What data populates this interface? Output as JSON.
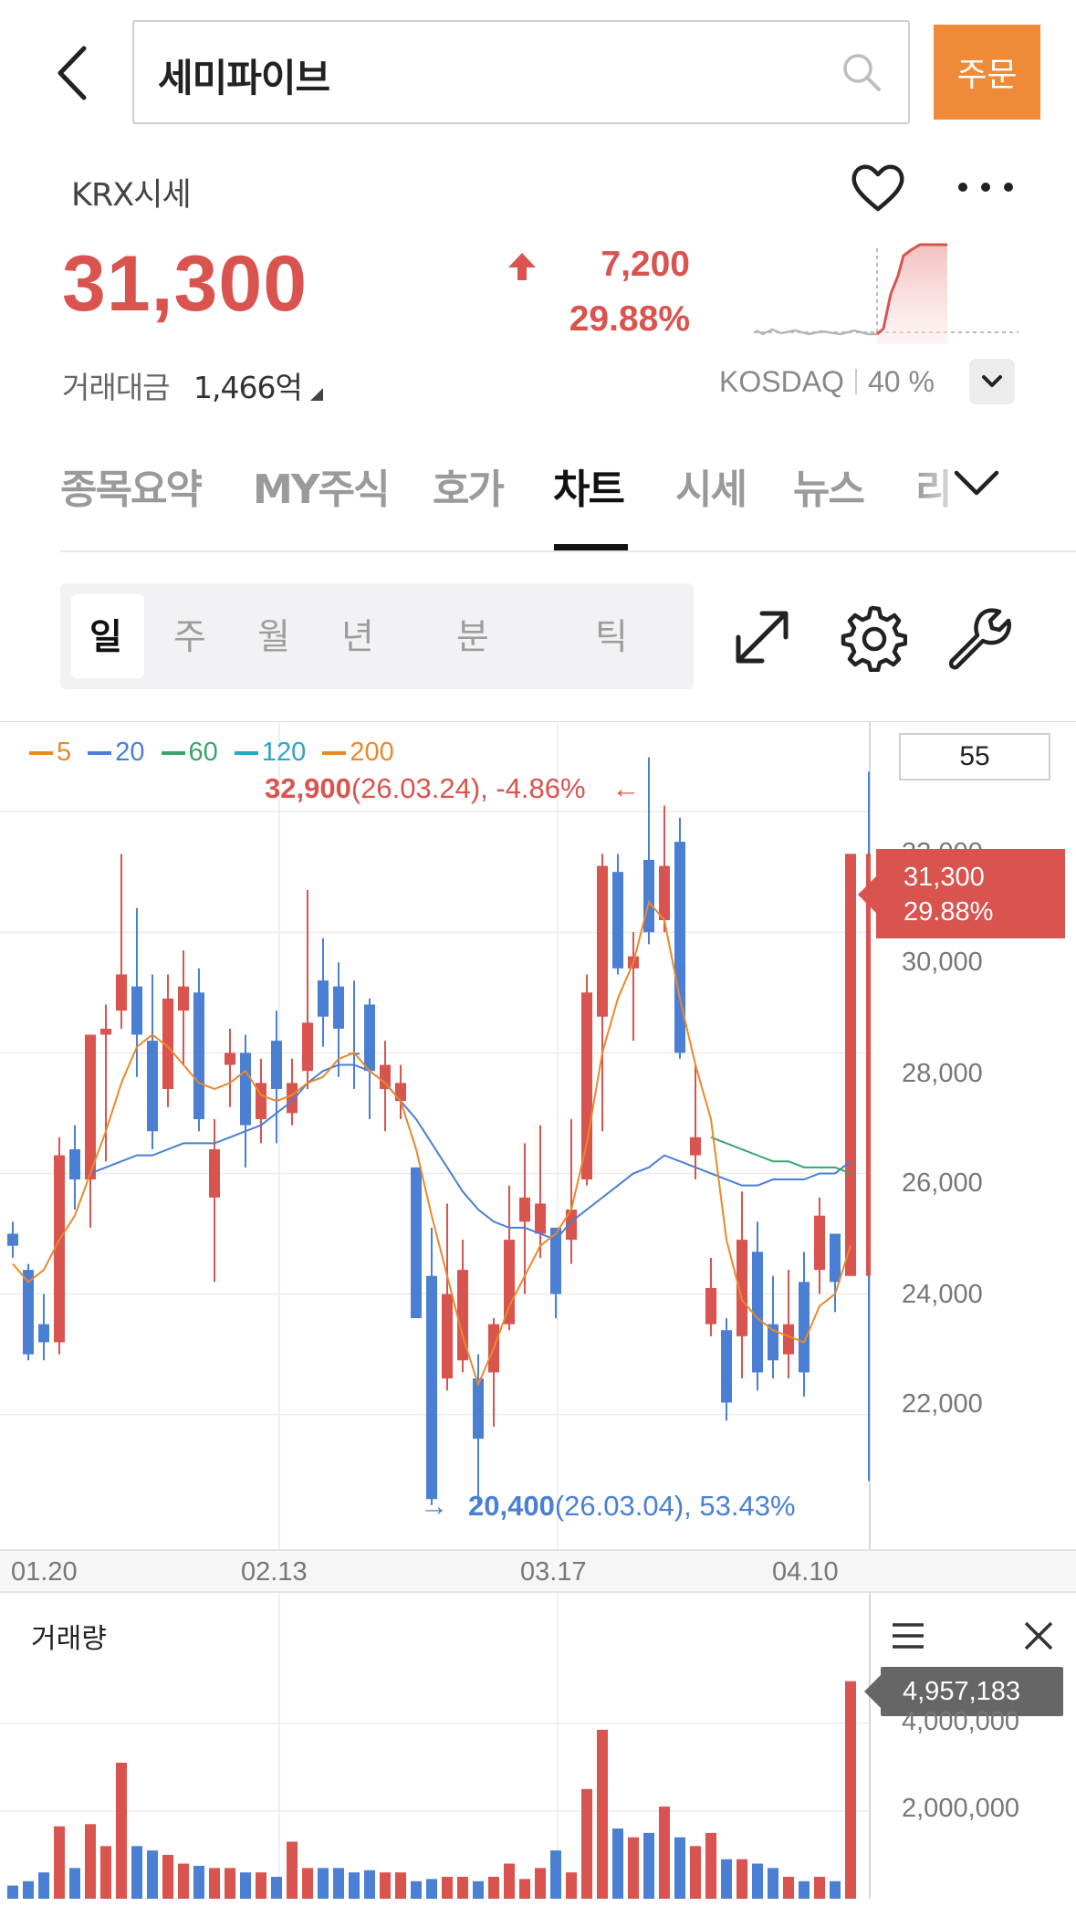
{
  "header": {
    "search_value": "세미파이브",
    "order_label": "주문"
  },
  "quote": {
    "market_label": "KRX시세",
    "price": "31,300",
    "change_abs": "7,200",
    "change_pct": "29.88%",
    "turnover_label": "거래대금",
    "turnover_value": "1,466억",
    "market_index": "KOSDAQ",
    "market_pct": "40 %"
  },
  "tabs": [
    {
      "label": "종목요약"
    },
    {
      "label": "MY주식"
    },
    {
      "label": "호가"
    },
    {
      "label": "차트"
    },
    {
      "label": "시세"
    },
    {
      "label": "뉴스"
    },
    {
      "label": "리"
    }
  ],
  "periods": [
    {
      "label": "일"
    },
    {
      "label": "주"
    },
    {
      "label": "월"
    },
    {
      "label": "년"
    },
    {
      "label": "분"
    },
    {
      "label": "틱"
    }
  ],
  "chart": {
    "count": "55",
    "legend": [
      {
        "label": "5",
        "color": "#e8892b"
      },
      {
        "label": "20",
        "color": "#4a7fd4"
      },
      {
        "label": "60",
        "color": "#3aa56a"
      },
      {
        "label": "120",
        "color": "#2aa7c8"
      },
      {
        "label": "200",
        "color": "#e8892b"
      }
    ],
    "max_note_value": "32,900",
    "max_note_detail": "(26.03.24), -4.86%",
    "max_arrow": "←",
    "min_note_value": "20,400",
    "min_note_detail": "(26.03.04), 53.43%",
    "min_arrow": "→",
    "tag_price": "31,300",
    "tag_pct": "29.88%",
    "y_ticks": [
      "32,000",
      "30,000",
      "28,000",
      "26,000",
      "24,000",
      "22,000"
    ],
    "x_ticks": [
      "01.20",
      "02.13",
      "03.17",
      "04.10"
    ],
    "volume_title": "거래량",
    "volume_tag": "4,957,183",
    "volume_ticks": [
      "4,000,000",
      "2,000,000"
    ]
  },
  "chart_data": {
    "type": "candlestick",
    "ylim": [
      19800,
      33500
    ],
    "candles": [
      {
        "o": 24800,
        "h": 25200,
        "l": 24600,
        "c": 25000,
        "up": false
      },
      {
        "o": 24400,
        "h": 24500,
        "l": 22900,
        "c": 23000,
        "up": false
      },
      {
        "o": 23500,
        "h": 24000,
        "l": 22900,
        "c": 23200,
        "up": false
      },
      {
        "o": 23200,
        "h": 26600,
        "l": 23000,
        "c": 26300,
        "up": true
      },
      {
        "o": 26400,
        "h": 26800,
        "l": 25400,
        "c": 25900,
        "up": false
      },
      {
        "o": 25900,
        "h": 28300,
        "l": 25100,
        "c": 28300,
        "up": true
      },
      {
        "o": 28300,
        "h": 28800,
        "l": 26200,
        "c": 28400,
        "up": true
      },
      {
        "o": 28700,
        "h": 31300,
        "l": 28400,
        "c": 29300,
        "up": true
      },
      {
        "o": 29100,
        "h": 30400,
        "l": 27600,
        "c": 28300,
        "up": false
      },
      {
        "o": 28200,
        "h": 29300,
        "l": 26400,
        "c": 26700,
        "up": false
      },
      {
        "o": 27400,
        "h": 29300,
        "l": 27100,
        "c": 28900,
        "up": true
      },
      {
        "o": 28700,
        "h": 29700,
        "l": 27800,
        "c": 29100,
        "up": true
      },
      {
        "o": 29000,
        "h": 29400,
        "l": 26700,
        "c": 26900,
        "up": false
      },
      {
        "o": 26400,
        "h": 26900,
        "l": 24200,
        "c": 25600,
        "up": true
      },
      {
        "o": 27800,
        "h": 28400,
        "l": 27100,
        "c": 28000,
        "up": true
      },
      {
        "o": 28000,
        "h": 28300,
        "l": 26100,
        "c": 26800,
        "up": false
      },
      {
        "o": 26900,
        "h": 27900,
        "l": 26500,
        "c": 27500,
        "up": true
      },
      {
        "o": 28200,
        "h": 28700,
        "l": 26500,
        "c": 27400,
        "up": false
      },
      {
        "o": 27000,
        "h": 27900,
        "l": 26800,
        "c": 27500,
        "up": true
      },
      {
        "o": 27700,
        "h": 30700,
        "l": 27400,
        "c": 28500,
        "up": true
      },
      {
        "o": 29200,
        "h": 29900,
        "l": 28100,
        "c": 28600,
        "up": false
      },
      {
        "o": 29100,
        "h": 29500,
        "l": 27600,
        "c": 28400,
        "up": false
      },
      {
        "o": 28000,
        "h": 29200,
        "l": 27400,
        "c": 28000,
        "up": false
      },
      {
        "o": 28800,
        "h": 28900,
        "l": 26900,
        "c": 27700,
        "up": false
      },
      {
        "o": 27800,
        "h": 28200,
        "l": 26700,
        "c": 27400,
        "up": true
      },
      {
        "o": 27500,
        "h": 27800,
        "l": 26900,
        "c": 27200,
        "up": true
      },
      {
        "o": 26100,
        "h": 26100,
        "l": 23600,
        "c": 23600,
        "up": false
      },
      {
        "o": 24300,
        "h": 25100,
        "l": 20500,
        "c": 20600,
        "up": false
      },
      {
        "o": 22600,
        "h": 25500,
        "l": 22400,
        "c": 24000,
        "up": true
      },
      {
        "o": 24400,
        "h": 24900,
        "l": 22700,
        "c": 22900,
        "up": true
      },
      {
        "o": 22600,
        "h": 23000,
        "l": 20500,
        "c": 21600,
        "up": false
      },
      {
        "o": 22700,
        "h": 23600,
        "l": 21800,
        "c": 23500,
        "up": true
      },
      {
        "o": 23500,
        "h": 25800,
        "l": 23400,
        "c": 24900,
        "up": true
      },
      {
        "o": 25600,
        "h": 26500,
        "l": 24000,
        "c": 25200,
        "up": true
      },
      {
        "o": 25000,
        "h": 26800,
        "l": 24600,
        "c": 25500,
        "up": true
      },
      {
        "o": 25100,
        "h": 25100,
        "l": 23600,
        "c": 24000,
        "up": false
      },
      {
        "o": 24900,
        "h": 26900,
        "l": 24500,
        "c": 25400,
        "up": true
      },
      {
        "o": 25900,
        "h": 29300,
        "l": 25800,
        "c": 29000,
        "up": true
      },
      {
        "o": 28600,
        "h": 31300,
        "l": 26700,
        "c": 31100,
        "up": true
      },
      {
        "o": 31000,
        "h": 31300,
        "l": 29300,
        "c": 29400,
        "up": false
      },
      {
        "o": 29400,
        "h": 30000,
        "l": 28200,
        "c": 29600,
        "up": true
      },
      {
        "o": 31200,
        "h": 32900,
        "l": 29800,
        "c": 30000,
        "up": false
      },
      {
        "o": 30200,
        "h": 32100,
        "l": 30000,
        "c": 31100,
        "up": true
      },
      {
        "o": 31500,
        "h": 31900,
        "l": 27900,
        "c": 28000,
        "up": false
      },
      {
        "o": 26300,
        "h": 27800,
        "l": 25900,
        "c": 26600,
        "up": true
      },
      {
        "o": 24100,
        "h": 24600,
        "l": 23300,
        "c": 23500,
        "up": true
      },
      {
        "o": 23400,
        "h": 23600,
        "l": 21900,
        "c": 22200,
        "up": false
      },
      {
        "o": 23300,
        "h": 25700,
        "l": 22600,
        "c": 24900,
        "up": true
      },
      {
        "o": 24700,
        "h": 25200,
        "l": 22400,
        "c": 22700,
        "up": false
      },
      {
        "o": 23500,
        "h": 24300,
        "l": 22600,
        "c": 22900,
        "up": false
      },
      {
        "o": 23000,
        "h": 24400,
        "l": 22600,
        "c": 23500,
        "up": true
      },
      {
        "o": 24200,
        "h": 24700,
        "l": 22300,
        "c": 22700,
        "up": false
      },
      {
        "o": 24400,
        "h": 25600,
        "l": 24000,
        "c": 25300,
        "up": true
      },
      {
        "o": 25000,
        "h": 25000,
        "l": 23700,
        "c": 24200,
        "up": false
      },
      {
        "o": 24300,
        "h": 31300,
        "l": 24300,
        "c": 31300,
        "up": true
      }
    ],
    "ma5": [
      24500,
      24200,
      24400,
      24900,
      25300,
      26000,
      26700,
      27500,
      28100,
      28300,
      28100,
      27800,
      27500,
      27400,
      27500,
      27700,
      27300,
      27200,
      27300,
      27500,
      27600,
      27900,
      28000,
      27700,
      27500,
      27200,
      26400,
      25300,
      24300,
      23300,
      22500,
      23100,
      23800,
      24300,
      24800,
      25000,
      25400,
      26500,
      28000,
      28900,
      29500,
      30500,
      30200,
      28900,
      27800,
      26900,
      24900,
      23900,
      23600,
      23400,
      23300,
      23200,
      23800,
      24000,
      24800
    ],
    "ma20": [
      null,
      null,
      null,
      null,
      null,
      26000,
      26100,
      26200,
      26300,
      26300,
      26400,
      26500,
      26500,
      26500,
      26600,
      26700,
      26800,
      27000,
      27200,
      27500,
      27700,
      27800,
      27800,
      27700,
      27500,
      27200,
      26900,
      26500,
      26100,
      25700,
      25400,
      25200,
      25100,
      25100,
      25000,
      24900,
      25200,
      25400,
      25600,
      25800,
      26000,
      26100,
      26300,
      26200,
      26100,
      26000,
      25900,
      25800,
      25800,
      25900,
      25900,
      25900,
      26000,
      26000,
      26200
    ],
    "ma60": [
      null,
      null,
      null,
      null,
      null,
      null,
      null,
      null,
      null,
      null,
      null,
      null,
      null,
      null,
      null,
      null,
      null,
      null,
      null,
      null,
      null,
      null,
      null,
      null,
      null,
      null,
      null,
      null,
      null,
      null,
      null,
      null,
      null,
      null,
      null,
      null,
      null,
      null,
      null,
      null,
      null,
      null,
      null,
      null,
      null,
      26600,
      26500,
      26400,
      26300,
      26200,
      26200,
      26100,
      26100,
      26100,
      26000
    ],
    "volume": [
      300000,
      400000,
      600000,
      1650000,
      700000,
      1700000,
      1200000,
      3100000,
      1200000,
      1100000,
      1000000,
      800000,
      750000,
      700000,
      700000,
      600000,
      600000,
      500000,
      1300000,
      700000,
      700000,
      700000,
      600000,
      650000,
      600000,
      600000,
      400000,
      450000,
      500000,
      500000,
      400000,
      500000,
      800000,
      450000,
      700000,
      1100000,
      600000,
      2500000,
      3850000,
      1600000,
      1400000,
      1500000,
      2100000,
      1400000,
      1200000,
      1500000,
      900000,
      900000,
      800000,
      700000,
      500000,
      400000,
      500000,
      400000,
      4957183
    ],
    "volume_ylim": [
      0,
      5200000
    ]
  }
}
